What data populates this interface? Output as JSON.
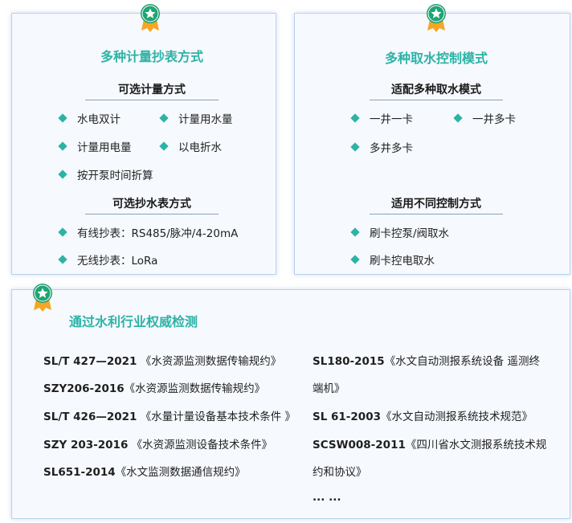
{
  "card1": {
    "title": "多种计量抄表方式",
    "section1": {
      "title": "可选计量方式",
      "items": [
        "水电双计",
        "计量用水量",
        "计量用电量",
        "以电折水",
        "按开泵时间折算"
      ]
    },
    "section2": {
      "title": "可选抄水表方式",
      "items": [
        "有线抄表：RS485/脉冲/4-20mA",
        "无线抄表：LoRa"
      ]
    }
  },
  "card2": {
    "title": "多种取水控制模式",
    "section1": {
      "title": "适配多种取水模式",
      "items": [
        "一井一卡",
        "一井多卡",
        "多井多卡"
      ]
    },
    "section2": {
      "title": "适用不同控制方式",
      "items": [
        "刷卡控泵/阀取水",
        "刷卡控电取水"
      ]
    }
  },
  "card3": {
    "title": "通过水利行业权威检测",
    "left": [
      {
        "code": "SL/T 427—2021",
        "name": "《水资源监测数据传输规约》"
      },
      {
        "code": "SZY206-2016",
        "name": "《水资源监测数据传输规约》"
      },
      {
        "code": "SL/T 426—2021",
        "name": "《水量计量设备基本技术条件 》"
      },
      {
        "code": "SZY 203-2016",
        "name": "《水资源监测设备技术条件》"
      },
      {
        "code": "SL651-2014",
        "name": "《水文监测数据通信规约》"
      }
    ],
    "right": [
      {
        "code": "SL180-2015",
        "name": "《水文自动测报系统设备 遥测终",
        "cont": "端机》"
      },
      {
        "code": "SL 61-2003",
        "name": "《水文自动测报系统技术规范》"
      },
      {
        "code": "SCSW008-2011",
        "name": "《四川省水文测报系统技术规",
        "cont": "约和协议》"
      }
    ],
    "ellipsis": "... ..."
  },
  "colors": {
    "accent": "#2cb3a6",
    "badge_green": "#1a9e6e",
    "badge_orange": "#f5a623",
    "card_bg": "#f6f9fe",
    "card_border": "#b9d2ec"
  }
}
